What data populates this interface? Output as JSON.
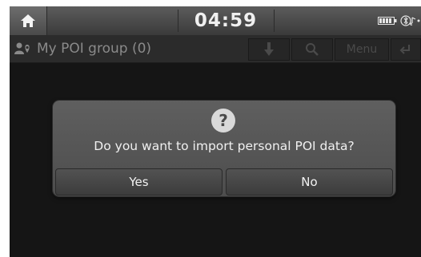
{
  "status_bar": {
    "clock": "04:59",
    "home_icon": "home-icon",
    "battery_icon": "battery-icon",
    "bluetooth_icon": "bluetooth-icon"
  },
  "toolbar": {
    "title": "My POI group (0)",
    "download_icon": "download-icon",
    "search_icon": "search-icon",
    "menu_label": "Menu",
    "back_icon": "back-icon"
  },
  "dialog": {
    "icon": "question-icon",
    "question_mark": "?",
    "message": "Do you want to import personal POI data?",
    "yes_label": "Yes",
    "no_label": "No"
  },
  "colors": {
    "background": "#151515",
    "dialog": "#575757",
    "text": "#f0f0f0"
  }
}
